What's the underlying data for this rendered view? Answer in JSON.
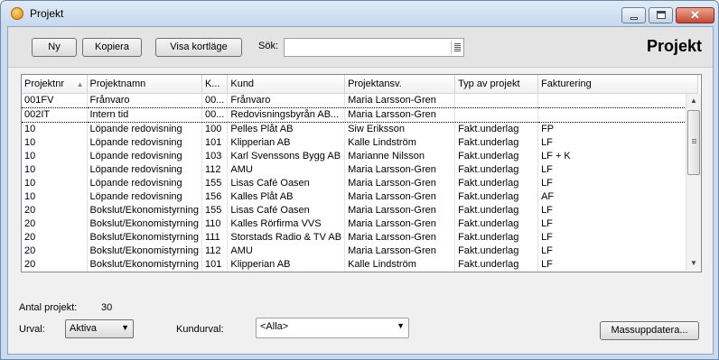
{
  "window": {
    "title": "Projekt",
    "icon": "app-logo-icon"
  },
  "toolbar": {
    "new_label": "Ny",
    "copy_label": "Kopiera",
    "card_label": "Visa kortläge",
    "search_label": "Sök:",
    "search_value": "",
    "heading": "Projekt"
  },
  "grid": {
    "columns": [
      "Projektnr",
      "Projektnamn",
      "K...",
      "Kund",
      "Projektansv.",
      "Typ av projekt",
      "Fakturering"
    ],
    "sort_indicator": "▲",
    "rows": [
      [
        "001FV",
        "Frånvaro",
        "00...",
        "Frånvaro",
        "Maria Larsson-Gren",
        "",
        ""
      ],
      [
        "002IT",
        "Intern tid",
        "00...",
        "Redovisningsbyrån AB...",
        "Maria Larsson-Gren",
        "",
        ""
      ],
      [
        "10",
        "Löpande redovisning",
        "100",
        "Pelles Plåt AB",
        "Siw Eriksson",
        "Fakt.underlag",
        "FP"
      ],
      [
        "10",
        "Löpande redovisning",
        "101",
        "Klipperian AB",
        "Kalle Lindström",
        "Fakt.underlag",
        "LF"
      ],
      [
        "10",
        "Löpande redovisning",
        "103",
        "Karl Svenssons Bygg AB",
        "Marianne Nilsson",
        "Fakt.underlag",
        "LF + K"
      ],
      [
        "10",
        "Löpande redovisning",
        "112",
        "AMU",
        "Maria Larsson-Gren",
        "Fakt.underlag",
        "LF"
      ],
      [
        "10",
        "Löpande redovisning",
        "155",
        "Lisas Café Oasen",
        "Maria Larsson-Gren",
        "Fakt.underlag",
        "LF"
      ],
      [
        "10",
        "Löpande redovisning",
        "156",
        "Kalles Plåt AB",
        "Maria Larsson-Gren",
        "Fakt.underlag",
        "AF"
      ],
      [
        "20",
        "Bokslut/Ekonomistyrning",
        "155",
        "Lisas Café Oasen",
        "Maria Larsson-Gren",
        "Fakt.underlag",
        "LF"
      ],
      [
        "20",
        "Bokslut/Ekonomistyrning",
        "110",
        "Kalles Rörfirma VVS",
        "Maria Larsson-Gren",
        "Fakt.underlag",
        "LF"
      ],
      [
        "20",
        "Bokslut/Ekonomistyrning",
        "111",
        "Storstads Radio & TV AB",
        "Maria Larsson-Gren",
        "Fakt.underlag",
        "LF"
      ],
      [
        "20",
        "Bokslut/Ekonomistyrning",
        "112",
        "AMU",
        "Maria Larsson-Gren",
        "Fakt.underlag",
        "LF"
      ],
      [
        "20",
        "Bokslut/Ekonomistyrning",
        "101",
        "Klipperian AB",
        "Kalle Lindström",
        "Fakt.underlag",
        "LF"
      ]
    ],
    "selected_row": 1
  },
  "footer": {
    "count_label": "Antal projekt:",
    "count_value": "30",
    "urval_label": "Urval:",
    "urval_value": "Aktiva",
    "kundurval_label": "Kundurval:",
    "kundurval_value": "<Alla>",
    "mass_update_label": "Massuppdatera..."
  }
}
